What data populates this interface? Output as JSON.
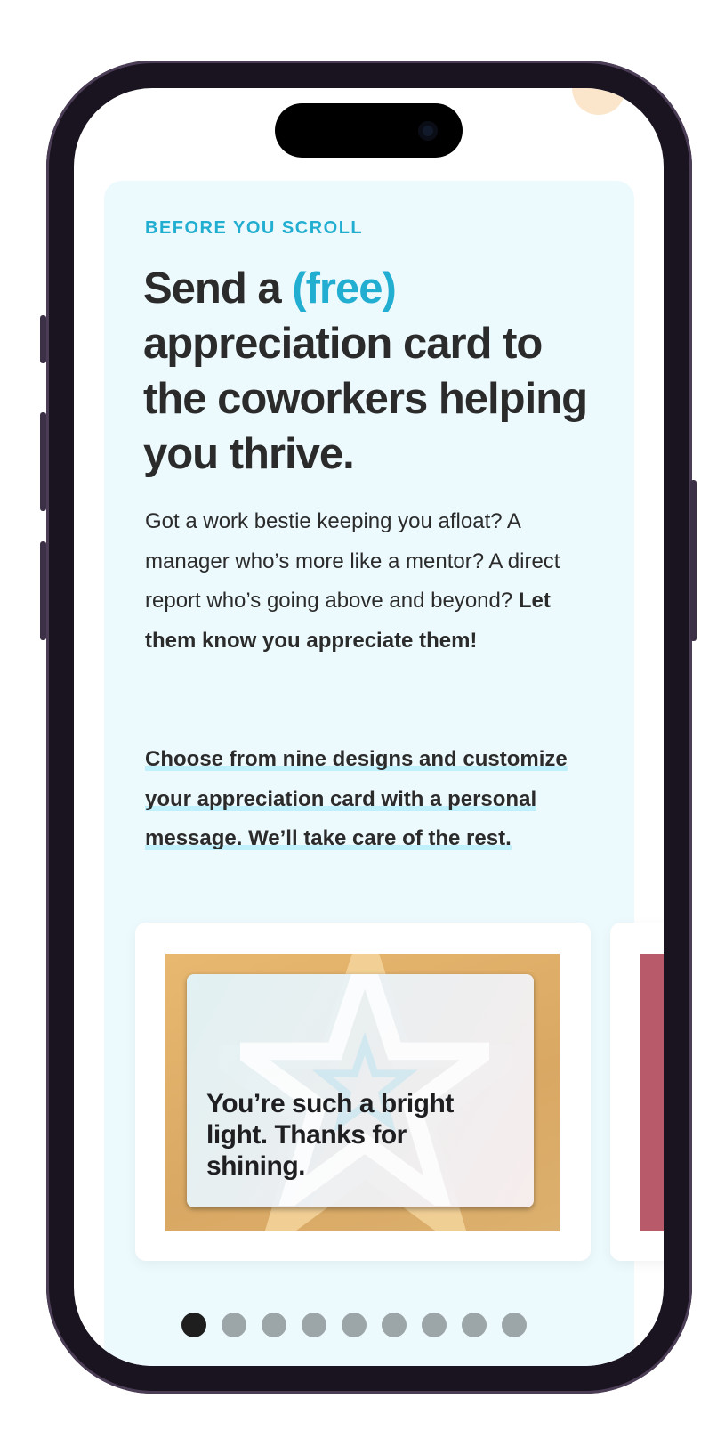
{
  "section": {
    "eyebrow": "BEFORE YOU SCROLL",
    "headline": {
      "before": "Send a ",
      "highlight": "(free)",
      "after": " appreciation card to the coworkers helping you thrive."
    },
    "paragraph1": {
      "text": "Got a work bestie keeping you afloat? A manager who’s more like a mentor? A direct report who’s going above and beyond? ",
      "bold": "Let them know you appreciate them!"
    },
    "paragraph2": "Choose from nine designs and customize your appreciation card with a personal message. We’ll take care of the rest."
  },
  "carousel": {
    "cards": [
      {
        "message": "You’re such a bright light. Thanks for shining.",
        "envelope_color": "#dcae68"
      },
      {
        "message": "",
        "envelope_color": "#b85a6a"
      }
    ],
    "total_designs": 9,
    "active_index": 0
  },
  "colors": {
    "accent": "#22aed1",
    "panel": "#ecf9fd",
    "text": "#2b2b2b"
  }
}
